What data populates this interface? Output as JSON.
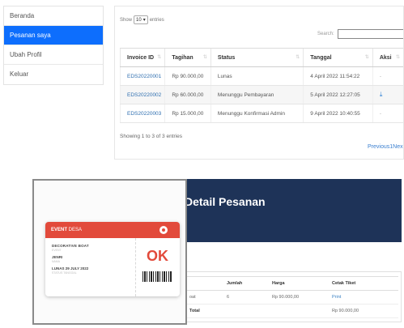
{
  "sidebar": {
    "items": [
      {
        "label": "Beranda",
        "active": false
      },
      {
        "label": "Pesanan saya",
        "active": true
      },
      {
        "label": "Ubah Profil",
        "active": false
      },
      {
        "label": "Keluar",
        "active": false
      }
    ]
  },
  "orders": {
    "show_prefix": "Show",
    "show_value": "10",
    "show_suffix": "entries",
    "search_label": "Search:",
    "search_value": "",
    "columns": [
      "Invoice ID",
      "Tagihan",
      "Status",
      "Tanggal",
      "Aksi"
    ],
    "rows": [
      {
        "invoice": "EDS20220001",
        "tagihan": "Rp 90.000,00",
        "status": "Lunas",
        "tanggal": "4 April 2022 11:54:22",
        "aksi": "-"
      },
      {
        "invoice": "EDS20220002",
        "tagihan": "Rp 60.000,00",
        "status": "Menunggu Pembayaran",
        "tanggal": "5 April 2022 12:27:05",
        "aksi": "download-icon"
      },
      {
        "invoice": "EDS20220003",
        "tagihan": "Rp 15.000,00",
        "status": "Menunggu Konfirmasi Admin",
        "tanggal": "9 April 2022 10:40:55",
        "aksi": "-"
      }
    ],
    "showing_text": "Showing 1 to 3 of 3 entries",
    "pager": {
      "previous": "Previous",
      "page": "1",
      "next": "Nex"
    }
  },
  "detail": {
    "title": "Detail Pesanan",
    "columns": [
      "Jumlah",
      "Harga",
      "Cetak Tiket"
    ],
    "row": {
      "item_fragment": "oat",
      "jumlah": "6",
      "harga": "Rp 90.000,00",
      "cetak": "Print"
    },
    "total_label": "Total",
    "total_value": "Rp 90.000,00"
  },
  "ticket": {
    "brand_bold": "EVENT",
    "brand_rest": " DESA",
    "event_name": "DECORATIVE BOAT",
    "event_caption": "EVENT",
    "holder_name": "JENRI",
    "holder_caption": "NAMA",
    "status_line": "LUNAS   29 JULY 2022",
    "status_caption": "STATUS       TANGGAL",
    "ok_text": "OK",
    "header_color": "#e24a3b"
  },
  "colors": {
    "primary": "#0d6efd",
    "link": "#2f6fb0",
    "banner": "#1e3358",
    "ticket_red": "#e24a3b"
  }
}
